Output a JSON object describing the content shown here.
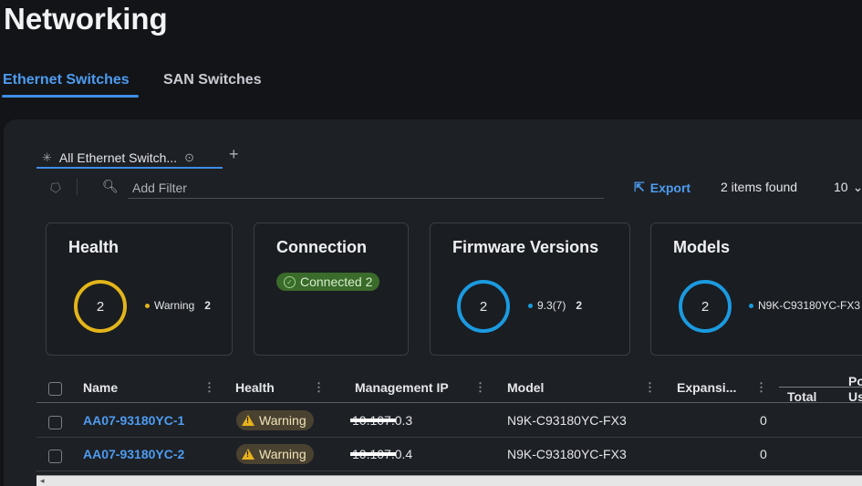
{
  "page_title": "Networking",
  "top_tabs": [
    {
      "label": "Ethernet Switches",
      "active": true
    },
    {
      "label": "SAN Switches",
      "active": false
    }
  ],
  "view_tab": {
    "label": "All Ethernet Switch...",
    "add_icon": "plus-icon",
    "settings_icon": "gear-icon",
    "pin_icon": "asterisk-icon"
  },
  "filter": {
    "placeholder": "Add Filter",
    "export_label": "Export",
    "items_found": "2 items found",
    "page_size": "10"
  },
  "cards": {
    "health": {
      "title": "Health",
      "total": "2",
      "legend_label": "Warning",
      "legend_count": "2",
      "color": "#e2b51a"
    },
    "connection": {
      "title": "Connection",
      "badge": "Connected 2",
      "color": "#3a6b2b"
    },
    "firmware": {
      "title": "Firmware Versions",
      "total": "2",
      "legend_label": "9.3(7)",
      "legend_count": "2",
      "color": "#1b9ae0"
    },
    "models": {
      "title": "Models",
      "total": "2",
      "legend_label": "N9K-C93180YC-FX3",
      "color": "#1b9ae0"
    }
  },
  "table": {
    "columns": {
      "name": "Name",
      "health": "Health",
      "mgmt_ip": "Management IP",
      "model": "Model",
      "expansion": "Expansi...",
      "total": "Total",
      "extra_top": "Po",
      "extra_bottom": "Us"
    },
    "rows": [
      {
        "name": "AA07-93180YC-1",
        "health": "Warning",
        "ip_redacted": "10.107.0",
        "ip_suffix": ".3",
        "model": "N9K-C93180YC-FX3",
        "expansion": "0"
      },
      {
        "name": "AA07-93180YC-2",
        "health": "Warning",
        "ip_redacted": "10.107.0",
        "ip_suffix": ".4",
        "model": "N9K-C93180YC-FX3",
        "expansion": "0"
      }
    ]
  }
}
